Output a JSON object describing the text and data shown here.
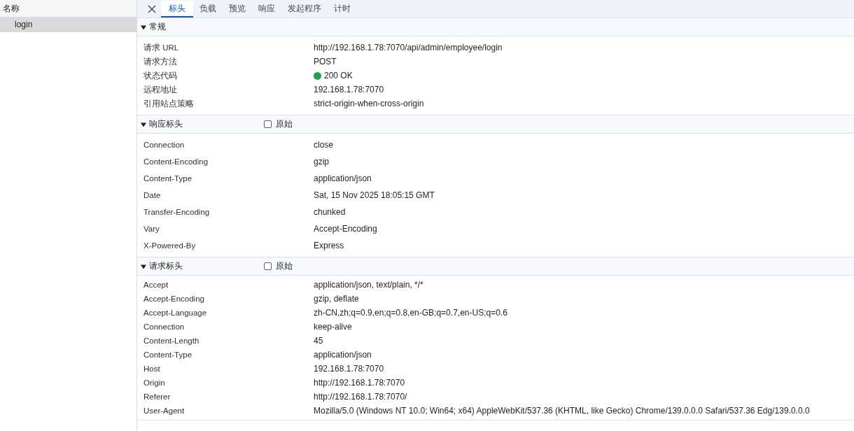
{
  "sidebar": {
    "column_header": "名称",
    "items": [
      {
        "name": "login",
        "selected": true
      }
    ]
  },
  "tabs": [
    {
      "label": "标头",
      "selected": true
    },
    {
      "label": "负载",
      "selected": false
    },
    {
      "label": "预览",
      "selected": false
    },
    {
      "label": "响应",
      "selected": false
    },
    {
      "label": "发起程序",
      "selected": false
    },
    {
      "label": "计时",
      "selected": false
    }
  ],
  "sections": [
    {
      "kind": "general",
      "title": "常规",
      "expanded": true,
      "rows": [
        {
          "name": "请求 URL",
          "value": "http://192.168.1.78:7070/api/admin/employee/login"
        },
        {
          "name": "请求方法",
          "value": "POST"
        },
        {
          "name": "状态代码",
          "value": "200 OK",
          "color": "#1ea446"
        },
        {
          "name": "远程地址",
          "value": "192.168.1.78:7070"
        },
        {
          "name": "引用站点策略",
          "value": "strict-origin-when-cross-origin"
        }
      ]
    },
    {
      "kind": "response_headers",
      "title": "响应标头",
      "expanded": true,
      "raw": {
        "label": "原始",
        "checked": false
      },
      "rows": [
        {
          "name": "Connection",
          "value": "close"
        },
        {
          "name": "Content-Encoding",
          "value": "gzip"
        },
        {
          "name": "Content-Type",
          "value": "application/json"
        },
        {
          "name": "Date",
          "value": "Sat, 15 Nov 2025 18:05:15 GMT"
        },
        {
          "name": "Transfer-Encoding",
          "value": "chunked"
        },
        {
          "name": "Vary",
          "value": "Accept-Encoding"
        },
        {
          "name": "X-Powered-By",
          "value": "Express"
        }
      ]
    },
    {
      "kind": "request_headers",
      "title": "请求标头",
      "expanded": true,
      "raw": {
        "label": "原始",
        "checked": false
      },
      "rows": [
        {
          "name": "Accept",
          "value": "application/json, text/plain, */*"
        },
        {
          "name": "Accept-Encoding",
          "value": "gzip, deflate"
        },
        {
          "name": "Accept-Language",
          "value": "zh-CN,zh;q=0.9,en;q=0.8,en-GB;q=0.7,en-US;q=0.6"
        },
        {
          "name": "Connection",
          "value": "keep-alive"
        },
        {
          "name": "Content-Length",
          "value": "45"
        },
        {
          "name": "Content-Type",
          "value": "application/json"
        },
        {
          "name": "Host",
          "value": "192.168.1.78:7070"
        },
        {
          "name": "Origin",
          "value": "http://192.168.1.78:7070"
        },
        {
          "name": "Referer",
          "value": "http://192.168.1.78:7070/"
        },
        {
          "name": "User-Agent",
          "value": "Mozilla/5.0 (Windows NT 10.0; Win64; x64) AppleWebKit/537.36 (KHTML, like Gecko) Chrome/139.0.0.0 Safari/537.36 Edg/139.0.0.0"
        }
      ]
    }
  ]
}
